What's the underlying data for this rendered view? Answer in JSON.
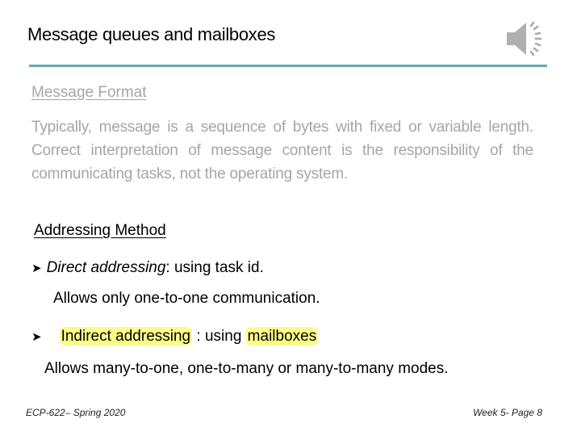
{
  "slide": {
    "title": "Message queues and mailboxes",
    "audio_icon": "speaker-icon",
    "accent_color": "#64a9b6",
    "highlight_color": "#fdfd8a"
  },
  "section1": {
    "heading": "Message Format",
    "paragraph": "Typically, message is a sequence of bytes with fixed or variable length.  Correct interpretation of message content is the responsibility of the communicating tasks, not the operating system."
  },
  "section2": {
    "heading": "Addressing  Method",
    "bullets": [
      {
        "icon": "arrow-bullet-icon",
        "term": "Direct addressing",
        "rest": ": using task id.",
        "sub": "Allows only one-to-one communication."
      },
      {
        "icon": "arrow-bullet-icon",
        "term": "Indirect addressing",
        "middle": " : using ",
        "term2": "mailboxes",
        "sub": "Allows many-to-one, one-to-many or many-to-many modes."
      }
    ]
  },
  "footer": {
    "left": "ECP-622– Spring 2020",
    "right": "Week 5- Page 8"
  }
}
